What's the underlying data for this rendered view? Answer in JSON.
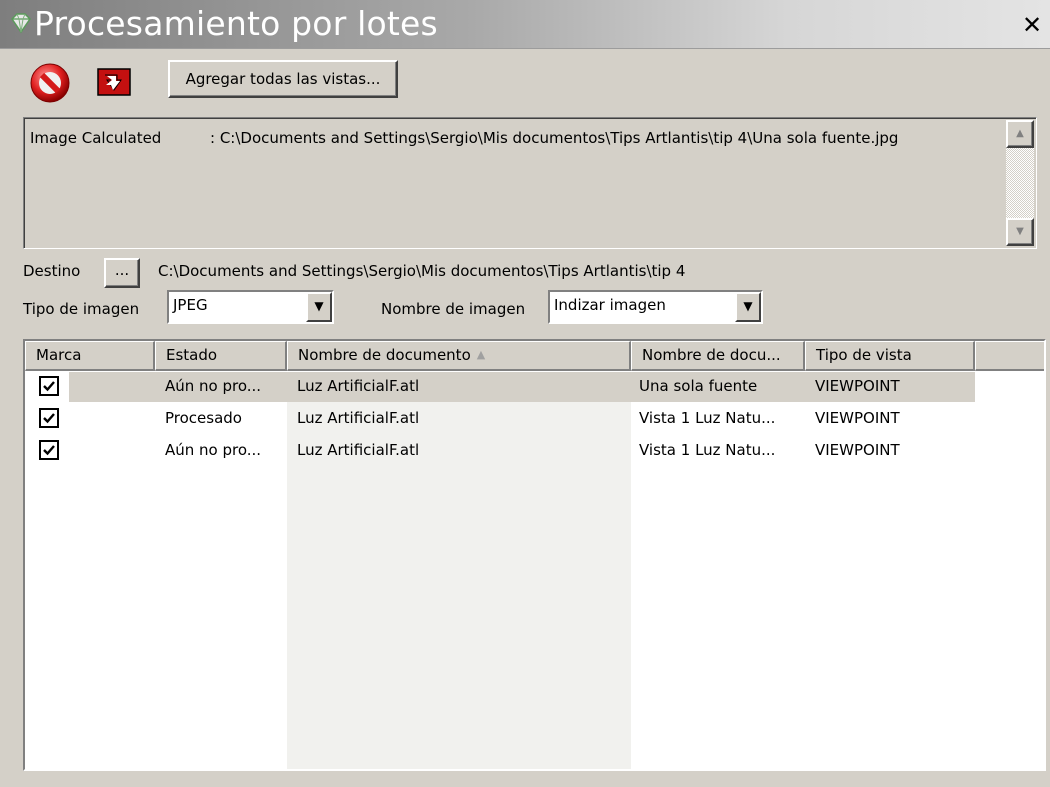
{
  "window": {
    "title": "Procesamiento por lotes",
    "close_glyph": "✕",
    "title_icon": "gem-icon"
  },
  "toolbar": {
    "stop_icon": "stop-icon",
    "render_icon": "render-icon",
    "add_views_label": "Agregar todas las vistas..."
  },
  "log": {
    "label": "Image Calculated",
    "value": ": C:\\Documents and Settings\\Sergio\\Mis documentos\\Tips Artlantis\\tip 4\\Una sola fuente.jpg"
  },
  "destination": {
    "label": "Destino",
    "browse_label": "...",
    "path": "C:\\Documents and Settings\\Sergio\\Mis documentos\\Tips Artlantis\\tip 4"
  },
  "image_type": {
    "label": "Tipo de imagen",
    "value": "JPEG"
  },
  "image_name": {
    "label": "Nombre de imagen",
    "value": "Indizar imagen"
  },
  "table": {
    "columns": [
      "Marca",
      "Estado",
      "Nombre de documento",
      "Nombre de docu...",
      "Tipo de vista"
    ],
    "rows": [
      {
        "checked": true,
        "estado": "Aún no pro...",
        "documento": "Luz ArtificialF.atl",
        "vista": "Una sola fuente",
        "tipo": "VIEWPOINT",
        "selected": true
      },
      {
        "checked": true,
        "estado": "Procesado",
        "documento": "Luz ArtificialF.atl",
        "vista": "Vista 1 Luz Natu...",
        "tipo": "VIEWPOINT",
        "selected": false
      },
      {
        "checked": true,
        "estado": "Aún no pro...",
        "documento": "Luz ArtificialF.atl",
        "vista": "Vista 1 Luz Natu...",
        "tipo": "VIEWPOINT",
        "selected": false
      }
    ]
  }
}
